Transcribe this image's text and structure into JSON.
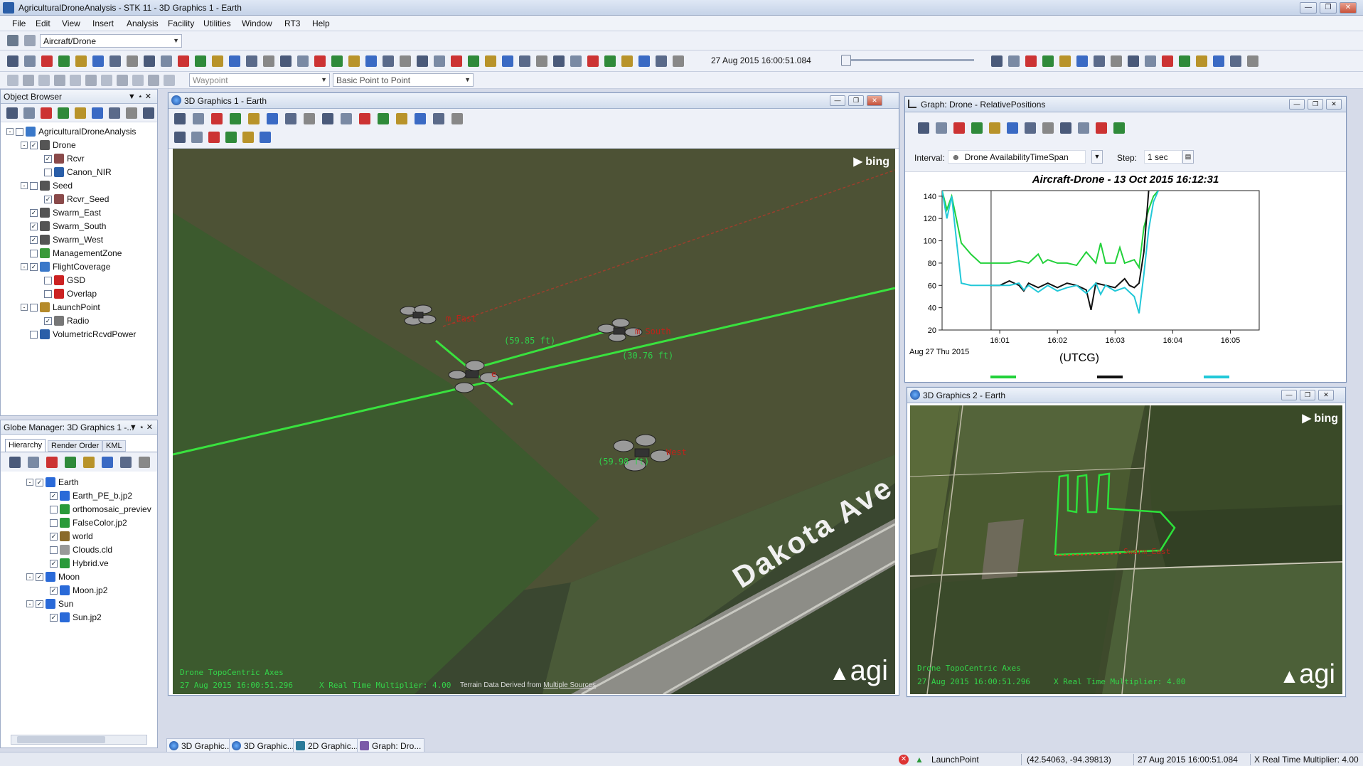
{
  "app": {
    "title": "AgriculturalDroneAnalysis - STK 11 - 3D Graphics 1 - Earth"
  },
  "menu": [
    "File",
    "Edit",
    "View",
    "Insert",
    "Analysis",
    "Facility",
    "Utilities",
    "Window",
    "RT3",
    "Help"
  ],
  "toolbar": {
    "object_combo": "Aircraft/Drone",
    "waypoint_combo": "Waypoint",
    "route_combo": "Basic Point to Point",
    "time": "27 Aug 2015 16:00:51.084"
  },
  "object_browser": {
    "title": "Object Browser",
    "items": [
      {
        "label": "AgriculturalDroneAnalysis",
        "depth": 0,
        "exp": "-",
        "cb": "",
        "color": "#3a78c9"
      },
      {
        "label": "Drone",
        "depth": 1,
        "exp": "-",
        "cb": "✓",
        "color": "#555"
      },
      {
        "label": "Rcvr",
        "depth": 2,
        "exp": "",
        "cb": "✓",
        "color": "#8a4a4a"
      },
      {
        "label": "Canon_NIR",
        "depth": 2,
        "exp": "",
        "cb": "",
        "color": "#2a5ea8"
      },
      {
        "label": "Seed",
        "depth": 1,
        "exp": "-",
        "cb": "",
        "color": "#555"
      },
      {
        "label": "Rcvr_Seed",
        "depth": 2,
        "exp": "",
        "cb": "✓",
        "color": "#8a4a4a"
      },
      {
        "label": "Swarm_East",
        "depth": 1,
        "exp": "",
        "cb": "✓",
        "color": "#555"
      },
      {
        "label": "Swarm_South",
        "depth": 1,
        "exp": "",
        "cb": "✓",
        "color": "#555"
      },
      {
        "label": "Swarm_West",
        "depth": 1,
        "exp": "",
        "cb": "✓",
        "color": "#555"
      },
      {
        "label": "ManagementZone",
        "depth": 1,
        "exp": "",
        "cb": "",
        "color": "#3a9a3a"
      },
      {
        "label": "FlightCoverage",
        "depth": 1,
        "exp": "-",
        "cb": "✓",
        "color": "#3a78c9"
      },
      {
        "label": "GSD",
        "depth": 2,
        "exp": "",
        "cb": "",
        "color": "#cc2222"
      },
      {
        "label": "Overlap",
        "depth": 2,
        "exp": "",
        "cb": "",
        "color": "#cc2222"
      },
      {
        "label": "LaunchPoint",
        "depth": 1,
        "exp": "-",
        "cb": "",
        "color": "#b58a2a"
      },
      {
        "label": "Radio",
        "depth": 2,
        "exp": "",
        "cb": "✓",
        "color": "#777"
      },
      {
        "label": "VolumetricRcvdPower",
        "depth": 1,
        "exp": "",
        "cb": "",
        "color": "#2a5ea8"
      }
    ]
  },
  "globe_manager": {
    "title": "Globe Manager: 3D Graphics 1 -...",
    "tabs": [
      "Hierarchy",
      "Render Order",
      "KML"
    ],
    "items": [
      {
        "label": "Earth",
        "depth": 0,
        "exp": "-",
        "cb": "✓",
        "color": "#2a6ad8"
      },
      {
        "label": "Earth_PE_b.jp2",
        "depth": 1,
        "exp": "",
        "cb": "✓",
        "color": "#2a6ad8"
      },
      {
        "label": "orthomosaic_previev",
        "depth": 1,
        "exp": "",
        "cb": "",
        "color": "#2a9a3a"
      },
      {
        "label": "FalseColor.jp2",
        "depth": 1,
        "exp": "",
        "cb": "",
        "color": "#2a9a3a"
      },
      {
        "label": "world",
        "depth": 1,
        "exp": "",
        "cb": "✓",
        "color": "#8a6a2a"
      },
      {
        "label": "Clouds.cld",
        "depth": 1,
        "exp": "",
        "cb": "",
        "color": "#999"
      },
      {
        "label": "Hybrid.ve",
        "depth": 1,
        "exp": "",
        "cb": "✓",
        "color": "#2a9a3a"
      },
      {
        "label": "Moon",
        "depth": 0,
        "exp": "-",
        "cb": "✓",
        "color": "#2a6ad8"
      },
      {
        "label": "Moon.jp2",
        "depth": 1,
        "exp": "",
        "cb": "✓",
        "color": "#2a6ad8"
      },
      {
        "label": "Sun",
        "depth": 0,
        "exp": "-",
        "cb": "✓",
        "color": "#2a6ad8"
      },
      {
        "label": "Sun.jp2",
        "depth": 1,
        "exp": "",
        "cb": "✓",
        "color": "#2a6ad8"
      }
    ]
  },
  "gfx1": {
    "title": "3D Graphics 1 - Earth",
    "bing": "bing",
    "road": "Dakota Ave",
    "labels": {
      "east": "m_East",
      "south": "m_South",
      "west": "West",
      "mid": "e"
    },
    "dist1": "(59.85 ft)",
    "dist2": "(30.76 ft)",
    "dist3": "(59.98 ft)",
    "axes": "Drone TopoCentric Axes",
    "time": "27 Aug 2015 16:00:51.296",
    "multiplier": "X Real Time Multiplier: 4.00",
    "terrain_prefix": "Terrain Data Derived from",
    "terrain_link": "Multiple Sources",
    "logo": "agi"
  },
  "graph": {
    "title": "Graph: Drone - RelativePositions",
    "interval_label": "Interval:",
    "interval_value": "Drone AvailabilityTimeSpan",
    "step_label": "Step:",
    "step_value": "1 sec",
    "utcg": "(UTCG)"
  },
  "chart_data": {
    "type": "line",
    "title": "Aircraft-Drone - 13 Oct 2015 16:12:31",
    "xlabel": "(UTCG)",
    "x_date_label": "Aug 27 Thu 2015",
    "xticks": [
      "16:01",
      "16:02",
      "16:03",
      "16:04",
      "16:05"
    ],
    "xlim": [
      "16:00:00",
      "16:05:30"
    ],
    "ylim": [
      20,
      145
    ],
    "yticks": [
      20,
      40,
      60,
      80,
      100,
      120,
      140
    ],
    "grid": false,
    "series": [
      {
        "color": "#22d13a",
        "x": [
          "16:00:00",
          "16:00:05",
          "16:00:10",
          "16:00:20",
          "16:00:30",
          "16:00:40",
          "16:00:50",
          "16:01:10",
          "16:01:20",
          "16:01:30",
          "16:01:40",
          "16:01:45",
          "16:01:50",
          "16:02:00",
          "16:02:10",
          "16:02:20",
          "16:02:30",
          "16:02:40",
          "16:02:45",
          "16:02:50",
          "16:03:00",
          "16:03:05",
          "16:03:10",
          "16:03:20",
          "16:03:25",
          "16:03:30",
          "16:03:35",
          "16:03:40",
          "16:03:45"
        ],
        "y": [
          145,
          128,
          140,
          98,
          88,
          80,
          80,
          80,
          82,
          80,
          88,
          80,
          83,
          80,
          80,
          78,
          90,
          80,
          98,
          80,
          80,
          94,
          80,
          83,
          76,
          112,
          128,
          140,
          145
        ]
      },
      {
        "color": "#111111",
        "x": [
          "16:00:50",
          "16:01:00",
          "16:01:10",
          "16:01:20",
          "16:01:25",
          "16:01:30",
          "16:01:40",
          "16:01:50",
          "16:02:00",
          "16:02:10",
          "16:02:20",
          "16:02:30",
          "16:02:35",
          "16:02:40",
          "16:02:50",
          "16:03:00",
          "16:03:10",
          "16:03:15",
          "16:03:20",
          "16:03:25",
          "16:03:30",
          "16:03:35"
        ],
        "y": [
          60,
          60,
          64,
          60,
          55,
          62,
          58,
          62,
          58,
          62,
          60,
          56,
          38,
          62,
          60,
          58,
          66,
          60,
          58,
          62,
          90,
          145
        ]
      },
      {
        "color": "#22c8d8",
        "x": [
          "16:00:00",
          "16:00:05",
          "16:00:10",
          "16:00:15",
          "16:00:20",
          "16:00:30",
          "16:00:40",
          "16:00:50",
          "16:01:10",
          "16:01:20",
          "16:01:25",
          "16:01:30",
          "16:01:40",
          "16:01:50",
          "16:02:00",
          "16:02:10",
          "16:02:20",
          "16:02:30",
          "16:02:40",
          "16:02:45",
          "16:02:50",
          "16:03:00",
          "16:03:10",
          "16:03:20",
          "16:03:25",
          "16:03:30",
          "16:03:35",
          "16:03:40",
          "16:03:45"
        ],
        "y": [
          145,
          120,
          140,
          100,
          62,
          60,
          60,
          60,
          60,
          62,
          56,
          60,
          54,
          60,
          55,
          58,
          60,
          53,
          62,
          52,
          60,
          55,
          58,
          50,
          35,
          70,
          110,
          135,
          145
        ]
      }
    ],
    "marker_x": "16:00:51"
  },
  "gfx2": {
    "title": "3D Graphics 2 - Earth",
    "bing": "bing",
    "label": "Swarm_East",
    "axes": "Drone TopoCentric Axes",
    "time": "27 Aug 2015 16:00:51.296",
    "multiplier": "X Real Time Multiplier: 4.00",
    "logo": "agi"
  },
  "taskbar": [
    "3D Graphic...",
    "3D Graphic...",
    "2D Graphic...",
    "Graph:  Dro..."
  ],
  "status": {
    "object": "LaunchPoint",
    "coords": "(42.54063, -94.39813)",
    "time": "27 Aug 2015 16:00:51.084",
    "multiplier": "X Real Time Multiplier: 4.00"
  }
}
